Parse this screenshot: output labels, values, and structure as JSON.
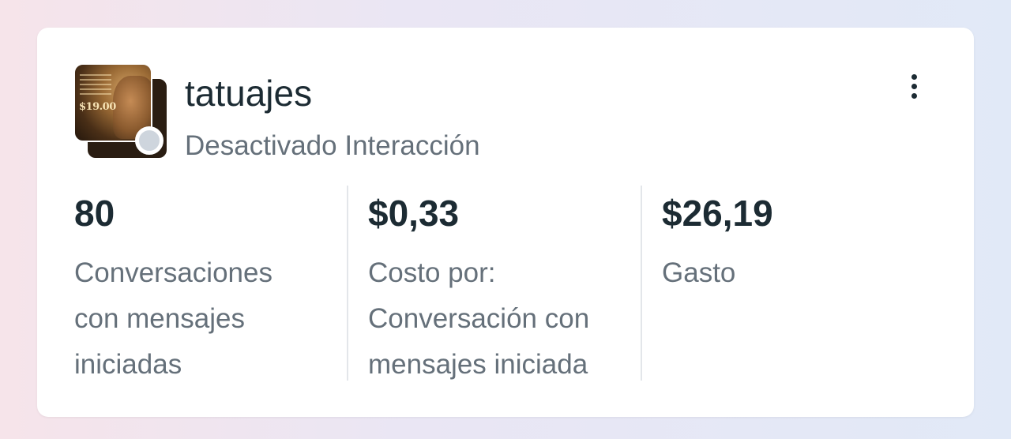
{
  "campaign": {
    "name": "tatuajes",
    "status": "Desactivado",
    "objective": "Interacción",
    "thumbnail_text": "$19.00",
    "status_color": "#ced5dd"
  },
  "menu_icon": "more-vertical-icon",
  "metrics": [
    {
      "value": "80",
      "label": "Conversaciones con mensajes iniciadas"
    },
    {
      "value": "$0,33",
      "label": "Costo por: Conversación con mensajes iniciada"
    },
    {
      "value": "$26,19",
      "label": "Gasto"
    }
  ]
}
